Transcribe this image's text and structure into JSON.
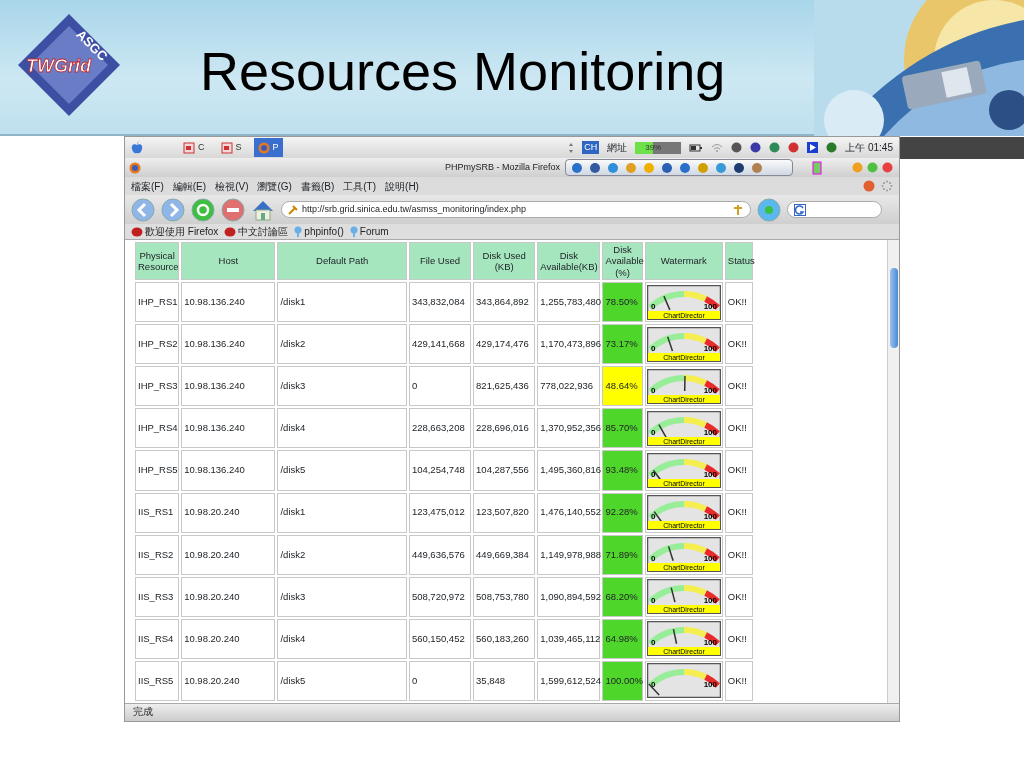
{
  "slide": {
    "logo": {
      "arc_text": "ASGC",
      "main_text": "TWGrid"
    },
    "title": "Resources Monitoring"
  },
  "menubar": {
    "apps": [
      {
        "label": "C",
        "selected": false
      },
      {
        "label": "S",
        "selected": false
      },
      {
        "label": "P",
        "selected": true
      }
    ],
    "input_method": "CH",
    "input_label": "網址",
    "battery": {
      "level": 0.39,
      "reading": "39%"
    },
    "clock": "上午 01:45"
  },
  "browser": {
    "title": "PHPmySRB - Mozilla Firefox",
    "menu": [
      "檔案(F)",
      "編輯(E)",
      "檢視(V)",
      "瀏覽(G)",
      "書籤(B)",
      "工具(T)",
      "說明(H)"
    ],
    "url": "http://srb.grid.sinica.edu.tw/asmss_monitoring/index.php",
    "bookmarks": [
      {
        "label": "歡迎使用 Firefox",
        "kind": "feed"
      },
      {
        "label": "中文討論區",
        "kind": "feed"
      },
      {
        "label": "phpinfo()",
        "kind": "pin"
      },
      {
        "label": "Forum",
        "kind": "pin"
      }
    ],
    "table": {
      "columns": [
        "Physical Resource",
        "Host",
        "Default Path",
        "File Used",
        "Disk Used (KB)",
        "Disk Available(KB)",
        "Disk Available (%)",
        "Watermark",
        "Status"
      ],
      "rows": [
        {
          "resource": "IHP_RS1",
          "host": "10.98.136.240",
          "path": "/disk1",
          "file_used": "343,832,084",
          "disk_used": "343,864,892",
          "disk_available": "1,255,783,480",
          "percent": {
            "text": "78.50%",
            "color": "#4fd62b"
          },
          "gauge": {
            "level": 0.215,
            "min_label": "0",
            "max_label": "100",
            "credit": "ChartDirector"
          },
          "status": "OK!!"
        },
        {
          "resource": "IHP_RS2",
          "host": "10.98.136.240",
          "path": "/disk2",
          "file_used": "429,141,668",
          "disk_used": "429,174,476",
          "disk_available": "1,170,473,896",
          "percent": {
            "text": "73.17%",
            "color": "#4fd62b"
          },
          "gauge": {
            "level": 0.268,
            "min_label": "0",
            "max_label": "100",
            "credit": "ChartDirector"
          },
          "status": "OK!!"
        },
        {
          "resource": "IHP_RS3",
          "host": "10.98.136.240",
          "path": "/disk3",
          "file_used": "0",
          "disk_used": "821,625,436",
          "disk_available": "778,022,936",
          "percent": {
            "text": "48.64%",
            "color": "#ffff00"
          },
          "gauge": {
            "level": 0.514,
            "min_label": "0",
            "max_label": "100",
            "credit": "ChartDirector"
          },
          "status": "OK!!"
        },
        {
          "resource": "IHP_RS4",
          "host": "10.98.136.240",
          "path": "/disk4",
          "file_used": "228,663,208",
          "disk_used": "228,696,016",
          "disk_available": "1,370,952,356",
          "percent": {
            "text": "85.70%",
            "color": "#4fd62b"
          },
          "gauge": {
            "level": 0.143,
            "min_label": "0",
            "max_label": "100",
            "credit": "ChartDirector"
          },
          "status": "OK!!"
        },
        {
          "resource": "IHP_RS5",
          "host": "10.98.136.240",
          "path": "/disk5",
          "file_used": "104,254,748",
          "disk_used": "104,287,556",
          "disk_available": "1,495,360,816",
          "percent": {
            "text": "93.48%",
            "color": "#4fd62b"
          },
          "gauge": {
            "level": 0.065,
            "min_label": "0",
            "max_label": "100",
            "credit": "ChartDirector"
          },
          "status": "OK!!"
        },
        {
          "resource": "IIS_RS1",
          "host": "10.98.20.240",
          "path": "/disk1",
          "file_used": "123,475,012",
          "disk_used": "123,507,820",
          "disk_available": "1,476,140,552",
          "percent": {
            "text": "92.28%",
            "color": "#4fd62b"
          },
          "gauge": {
            "level": 0.077,
            "min_label": "0",
            "max_label": "100",
            "credit": "ChartDirector"
          },
          "status": "OK!!"
        },
        {
          "resource": "IIS_RS2",
          "host": "10.98.20.240",
          "path": "/disk2",
          "file_used": "449,636,576",
          "disk_used": "449,669,384",
          "disk_available": "1,149,978,988",
          "percent": {
            "text": "71.89%",
            "color": "#4fd62b"
          },
          "gauge": {
            "level": 0.281,
            "min_label": "0",
            "max_label": "100",
            "credit": "ChartDirector"
          },
          "status": "OK!!"
        },
        {
          "resource": "IIS_RS3",
          "host": "10.98.20.240",
          "path": "/disk3",
          "file_used": "508,720,972",
          "disk_used": "508,753,780",
          "disk_available": "1,090,894,592",
          "percent": {
            "text": "68.20%",
            "color": "#4fd62b"
          },
          "gauge": {
            "level": 0.318,
            "min_label": "0",
            "max_label": "100",
            "credit": "ChartDirector"
          },
          "status": "OK!!"
        },
        {
          "resource": "IIS_RS4",
          "host": "10.98.20.240",
          "path": "/disk4",
          "file_used": "560,150,452",
          "disk_used": "560,183,260",
          "disk_available": "1,039,465,112",
          "percent": {
            "text": "64.98%",
            "color": "#4fd62b"
          },
          "gauge": {
            "level": 0.35,
            "min_label": "0",
            "max_label": "100",
            "credit": "ChartDirector"
          },
          "status": "OK!!"
        },
        {
          "resource": "IIS_RS5",
          "host": "10.98.20.240",
          "path": "/disk5",
          "file_used": "0",
          "disk_used": "35,848",
          "disk_available": "1,599,612,524",
          "percent": {
            "text": "100.00%",
            "color": "#4fd62b"
          },
          "gauge": {
            "level": 0.0,
            "min_label": "0",
            "max_label": "100"
          },
          "status": "OK!!"
        }
      ]
    },
    "status": "完成"
  }
}
